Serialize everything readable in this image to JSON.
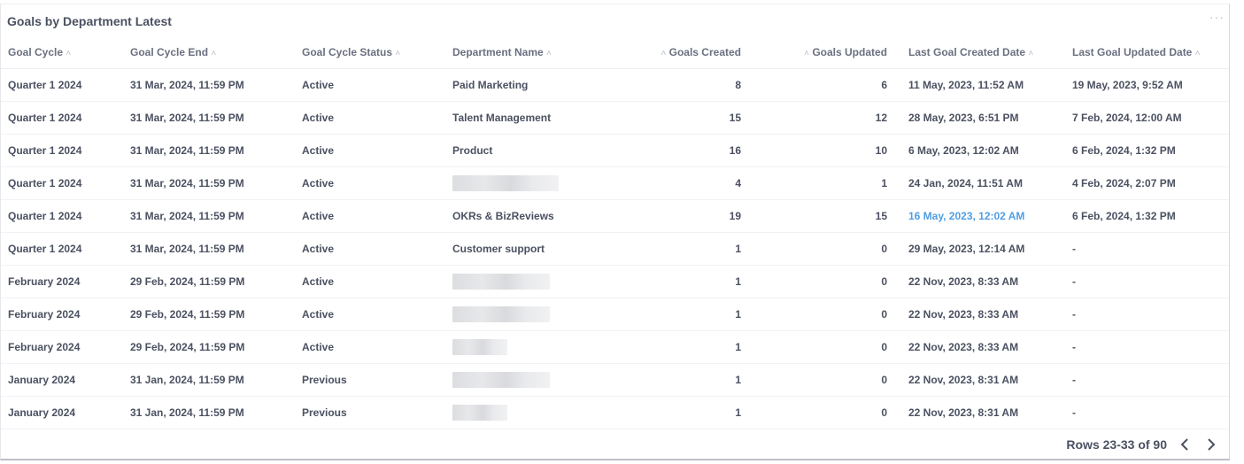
{
  "card": {
    "title": "Goals by Department Latest",
    "more_glyph": "···"
  },
  "table": {
    "columns": [
      "Goal Cycle",
      "Goal Cycle End",
      "Goal Cycle Status",
      "Department Name",
      "Goals Created",
      "Goals Updated",
      "Last Goal Created Date",
      "Last Goal Updated Date"
    ],
    "sort_glyph": "^",
    "rows": [
      [
        "Quarter 1 2024",
        "31 Mar, 2024, 11:59 PM",
        "Active",
        "Paid Marketing",
        "8",
        "6",
        "11 May, 2023, 11:52 AM",
        "19 May, 2023, 9:52 AM"
      ],
      [
        "Quarter 1 2024",
        "31 Mar, 2024, 11:59 PM",
        "Active",
        "Talent Management",
        "15",
        "12",
        "28 May, 2023, 6:51 PM",
        "7 Feb, 2024, 12:00 AM"
      ],
      [
        "Quarter 1 2024",
        "31 Mar, 2024, 11:59 PM",
        "Active",
        "Product",
        "16",
        "10",
        "6 May, 2023, 12:02 AM",
        "6 Feb, 2024, 1:32 PM"
      ],
      [
        "Quarter 1 2024",
        "31 Mar, 2024, 11:59 PM",
        "Active",
        "",
        "4",
        "1",
        "24 Jan, 2024, 11:51 AM",
        "4 Feb, 2024, 2:07 PM"
      ],
      [
        "Quarter 1 2024",
        "31 Mar, 2024, 11:59 PM",
        "Active",
        "OKRs & BizReviews",
        "19",
        "15",
        "16 May, 2023, 12:02 AM",
        "6 Feb, 2024, 1:32 PM"
      ],
      [
        "Quarter 1 2024",
        "31 Mar, 2024, 11:59 PM",
        "Active",
        "Customer support",
        "1",
        "0",
        "29 May, 2023, 12:14 AM",
        "-"
      ],
      [
        "February 2024",
        "29 Feb, 2024, 11:59 PM",
        "Active",
        "",
        "1",
        "0",
        "22 Nov, 2023, 8:33 AM",
        "-"
      ],
      [
        "February 2024",
        "29 Feb, 2024, 11:59 PM",
        "Active",
        "",
        "1",
        "0",
        "22 Nov, 2023, 8:33 AM",
        "-"
      ],
      [
        "February 2024",
        "29 Feb, 2024, 11:59 PM",
        "Active",
        "",
        "1",
        "0",
        "22 Nov, 2023, 8:33 AM",
        "-"
      ],
      [
        "January 2024",
        "31 Jan, 2024, 11:59 PM",
        "Previous",
        "",
        "1",
        "0",
        "22 Nov, 2023, 8:31 AM",
        "-"
      ],
      [
        "January 2024",
        "31 Jan, 2024, 11:59 PM",
        "Previous",
        "",
        "1",
        "0",
        "22 Nov, 2023, 8:31 AM",
        "-"
      ]
    ],
    "redacted_widths": [
      0,
      0,
      0,
      120,
      0,
      0,
      110,
      110,
      62,
      110,
      62
    ],
    "link_cells": [
      [
        4,
        6
      ]
    ],
    "link_color": "#509ee3"
  },
  "pagination": {
    "label": "Rows 23-33 of 90",
    "prev_icon": "chevron-left-icon",
    "next_icon": "chevron-right-icon"
  }
}
